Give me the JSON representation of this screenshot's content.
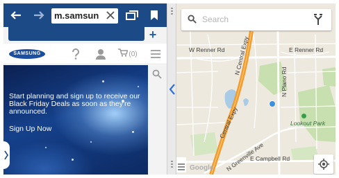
{
  "browser": {
    "url": "m.samsun",
    "back_icon": "back-arrow-icon",
    "forward_icon": "forward-arrow-icon",
    "clear_icon": "close-icon",
    "tabs_icon": "tabs-icon",
    "bookmark_icon": "bookmark-icon",
    "new_tab_label": "+",
    "colors": {
      "toolbar": "#1b4a87",
      "hero": "#15418c"
    }
  },
  "site": {
    "logo": "SAMSUNG",
    "help_icon": "question-icon",
    "account_icon": "person-icon",
    "cart_icon": "cart-icon",
    "cart_count": "(0)",
    "menu_icon": "hamburger-icon",
    "search_icon": "search-icon",
    "hero_text": "Start planning and sign up to receive our Black Friday Deals as soon as they're announced.",
    "hero_link": "Sign Up Now"
  },
  "map": {
    "search_placeholder": "Search",
    "search_icon": "search-icon",
    "directions_icon": "directions-icon",
    "locate_icon": "my-location-icon",
    "menu_icon": "hamburger-icon",
    "attribution": "Google",
    "labels": {
      "w_renner": "W Renner Rd",
      "e_renner": "E Renner Rd",
      "n_central": "N Central Expy",
      "n_plano": "N Plano Rd",
      "central_expy": "Central Expy",
      "n_greenville": "N Greenville Ave",
      "lookout_park": "Lookout Park",
      "e_campbell": "E Campbell Rd"
    },
    "colors": {
      "highway": "#f39b2c",
      "park": "#c8dfb0",
      "water": "#a9cbe6",
      "location": "#3d8fe0"
    }
  },
  "divider": {
    "arrow_icon": "chevron-left-icon"
  }
}
